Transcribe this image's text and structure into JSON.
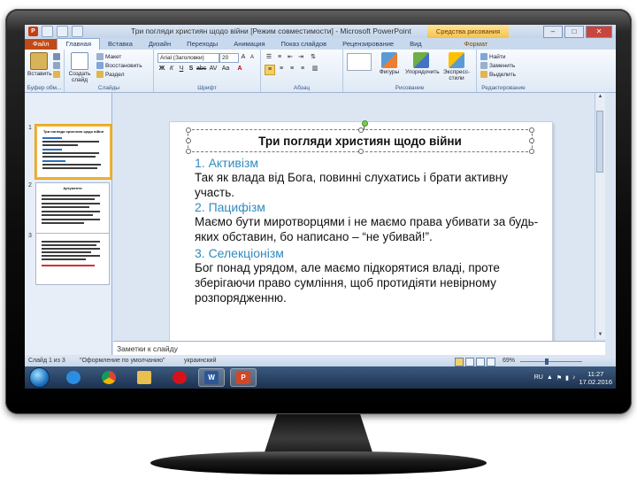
{
  "window": {
    "title": "Три погляди християн щодо війни [Режим совместимости] - Microsoft PowerPoint",
    "context_tab_header": "Средства рисования",
    "controls": [
      "–",
      "□",
      "✕"
    ]
  },
  "tabs": [
    {
      "label": "Файл"
    },
    {
      "label": "Главная"
    },
    {
      "label": "Вставка"
    },
    {
      "label": "Дизайн"
    },
    {
      "label": "Переходы"
    },
    {
      "label": "Анимация"
    },
    {
      "label": "Показ слайдов"
    },
    {
      "label": "Рецензирование"
    },
    {
      "label": "Вид"
    },
    {
      "label": "Формат"
    }
  ],
  "ribbon": {
    "clipboard": {
      "paste_label": "Вставить",
      "group_label": "Буфер обм..."
    },
    "slides": {
      "create_label": "Создать слайд",
      "layout_label": "Макет",
      "restore_label": "Восстановить",
      "section_label": "Раздел",
      "group_label": "Слайды"
    },
    "font": {
      "font_name": "Arial (Заголовки)",
      "font_size": "20",
      "group_label": "Шрифт"
    },
    "paragraph": {
      "group_label": "Абзац"
    },
    "drawing": {
      "shapes_label": "Фигуры",
      "arrange_label": "Упорядочить",
      "styles_label": "Экспресс-стили",
      "group_label": "Рисование"
    },
    "editing": {
      "find_label": "Найти",
      "replace_label": "Заменить",
      "select_label": "Выделить",
      "group_label": "Редактирование"
    }
  },
  "thumbnails": [
    {
      "number": "1",
      "title": "Три погляди християн щодо війни"
    },
    {
      "number": "2",
      "title": "Аргументи"
    },
    {
      "number": "3",
      "title": ""
    }
  ],
  "slide": {
    "title": "Три погляди християн щодо війни",
    "points": [
      {
        "heading": "1. Активізм",
        "text": "Так як влада від Бога, повинні слухатись і брати активну участь."
      },
      {
        "heading": "2. Пацифізм",
        "text": "Маємо бути миротворцями і не маємо права убивати за будь-яких обставин, бо написано – “не убивай!”."
      },
      {
        "heading": "3. Селекціонізм",
        "text": "Бог понад урядом, але маємо підкорятися владі, проте зберігаючи право сумління, щоб протидіяти невірному розпорядженню."
      }
    ]
  },
  "notes": {
    "placeholder": "Заметки к слайду"
  },
  "status": {
    "slide_info": "Слайд 1 из 3",
    "theme": "\"Оформление по умолчанию\"",
    "language": "украинский",
    "zoom": "69%"
  },
  "taskbar": {
    "apps": [
      {
        "name": "ie"
      },
      {
        "name": "chrome"
      },
      {
        "name": "explorer"
      },
      {
        "name": "opera"
      },
      {
        "name": "word",
        "glyph": "W"
      },
      {
        "name": "powerpoint",
        "glyph": "P"
      }
    ],
    "language": "RU",
    "time": "11:27",
    "date": "17.02.2016"
  },
  "colors": {
    "accent_heading": "#2e8bc0",
    "file_tab": "#c24a16",
    "context_tab": "#f4c24c"
  }
}
